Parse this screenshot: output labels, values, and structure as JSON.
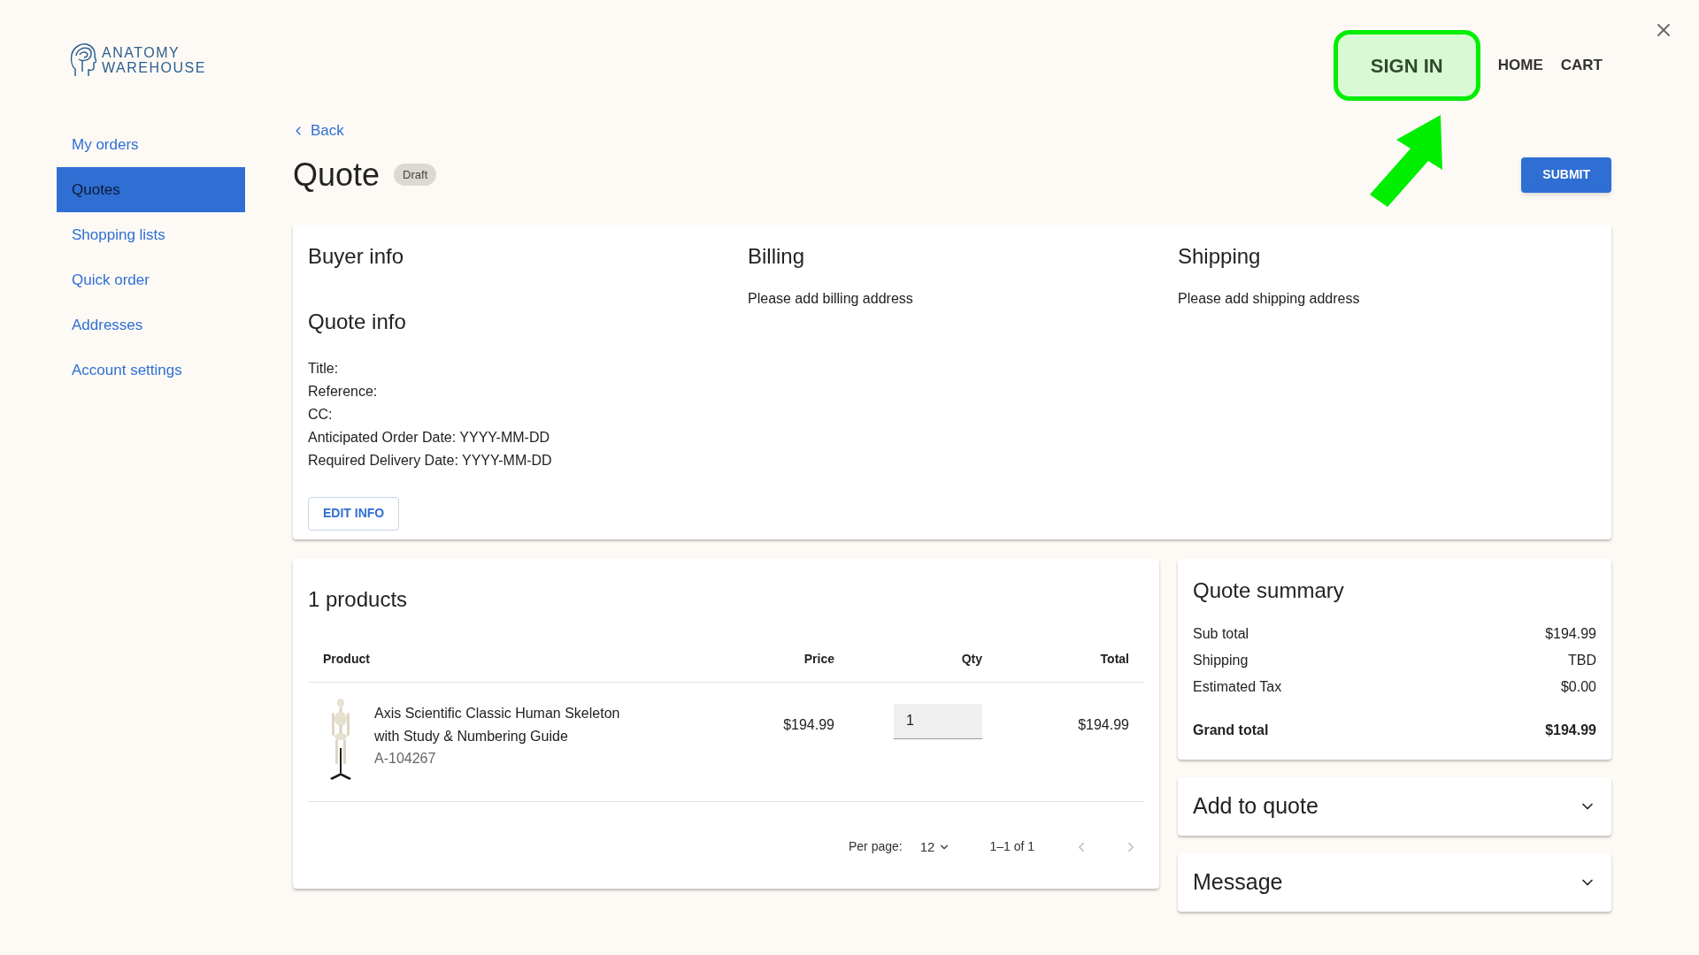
{
  "brand": {
    "line1": "ANATOMY",
    "line2": "WAREHOUSE"
  },
  "nav": [
    {
      "label": "SIGN IN",
      "highlighted": true
    },
    {
      "label": "HOME",
      "highlighted": false
    },
    {
      "label": "CART",
      "highlighted": false
    }
  ],
  "sidebar": {
    "items": [
      {
        "label": "My orders",
        "selected": false
      },
      {
        "label": "Quotes",
        "selected": true
      },
      {
        "label": "Shopping lists",
        "selected": false
      },
      {
        "label": "Quick order",
        "selected": false
      },
      {
        "label": "Addresses",
        "selected": false
      },
      {
        "label": "Account settings",
        "selected": false
      }
    ]
  },
  "back": "Back",
  "page": {
    "title": "Quote",
    "badge": "Draft",
    "submit": "SUBMIT"
  },
  "buyer_info": {
    "title": "Buyer info"
  },
  "quote_info": {
    "title": "Quote info",
    "fields": [
      "Title:",
      "Reference:",
      "CC:",
      "Anticipated Order Date: YYYY-MM-DD",
      "Required Delivery Date: YYYY-MM-DD"
    ],
    "button": "EDIT INFO"
  },
  "billing": {
    "title": "Billing",
    "text": "Please add billing address"
  },
  "shipping": {
    "title": "Shipping",
    "text": "Please add shipping address"
  },
  "products": {
    "title": "1 products",
    "columns": [
      "Product",
      "Price",
      "Qty",
      "Total"
    ],
    "rows": [
      {
        "name": "Axis Scientific Classic Human Skeleton with Study & Numbering Guide",
        "sku": "A-104267",
        "price": "$194.99",
        "qty": "1",
        "total": "$194.99"
      }
    ],
    "pagination": {
      "per_page_label": "Per page:",
      "per_page": "12",
      "range": "1–1 of 1"
    }
  },
  "summary": {
    "title": "Quote summary",
    "lines": [
      {
        "label": "Sub total",
        "value": "$194.99",
        "bold": false
      },
      {
        "label": "Shipping",
        "value": "TBD",
        "bold": false
      },
      {
        "label": "Estimated Tax",
        "value": "$0.00",
        "bold": false
      },
      {
        "label": "Grand total",
        "value": "$194.99",
        "bold": true
      }
    ]
  },
  "accordions": [
    {
      "title": "Add to quote",
      "expanded": false
    },
    {
      "title": "Message",
      "expanded": false
    }
  ]
}
